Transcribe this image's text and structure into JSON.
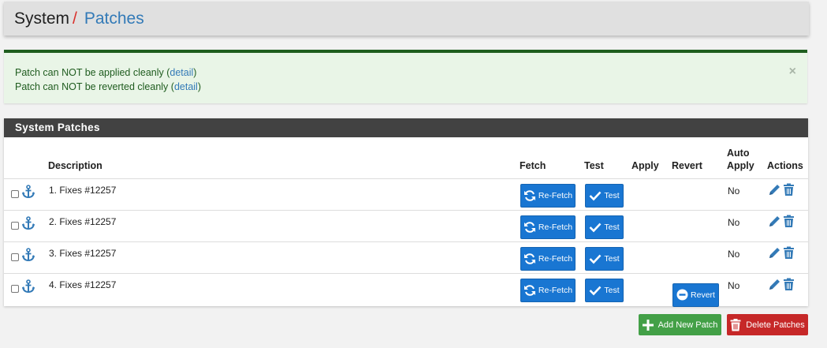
{
  "breadcrumb": {
    "system": "System",
    "separator": "/",
    "patches": "Patches"
  },
  "alert": {
    "line1_prefix": "Patch can NOT be applied cleanly (",
    "line1_link": "detail",
    "line1_suffix": ")",
    "line2_prefix": "Patch can NOT be reverted cleanly (",
    "line2_link": "detail",
    "line2_suffix": ")",
    "close": "×"
  },
  "panel": {
    "title": "System Patches",
    "columns": {
      "description": "Description",
      "fetch": "Fetch",
      "test": "Test",
      "apply": "Apply",
      "revert": "Revert",
      "auto_apply_1": "Auto",
      "auto_apply_2": "Apply",
      "actions": "Actions"
    },
    "rows": [
      {
        "description": "1. Fixes #12257",
        "fetch": "Re-Fetch",
        "test": "Test",
        "revert": "",
        "auto_apply": "No"
      },
      {
        "description": "2. Fixes #12257",
        "fetch": "Re-Fetch",
        "test": "Test",
        "revert": "",
        "auto_apply": "No"
      },
      {
        "description": "3. Fixes #12257",
        "fetch": "Re-Fetch",
        "test": "Test",
        "revert": "",
        "auto_apply": "No"
      },
      {
        "description": "4. Fixes #12257",
        "fetch": "Re-Fetch",
        "test": "Test",
        "revert": "Revert",
        "auto_apply": "No"
      }
    ]
  },
  "buttons": {
    "add": "Add New Patch",
    "delete": "Delete Patches"
  },
  "colors": {
    "primary": "#1976d2",
    "success": "#43a047",
    "danger": "#c62828",
    "link": "#337ab7",
    "separator": "#d9302c"
  }
}
